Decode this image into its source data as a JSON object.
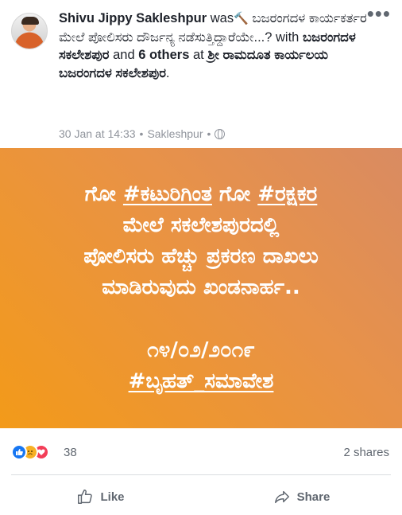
{
  "post": {
    "author": "Shivu Jippy Sakleshpur",
    "was_label": "was",
    "feeling_text": "ಬಜರಂಗದಳ ಕಾರ್ಯಕರ್ತರ ಮೇಲೆ ಪೋಲಿಸರು ದೌರ್ಜನ್ಯ ನಡೆಸುತ್ತಿದ್ದಾರೆಯೇ...?",
    "with_label": "with",
    "tagged_person": "ಬಜರಂಗದಳ ಸಕಲೇಶಪುರ",
    "and_label": "and",
    "others": "6 others",
    "at_label": "at",
    "location_tag": "ಶ್ರೀ ರಾಮದೂತ ಕಾರ್ಯಲಯ ಬಜರಂಗದಳ ಸಕಲೇಶಪುರ",
    "end_dot": ".",
    "timestamp": "30 Jan at 14:33",
    "place": "Sakleshpur",
    "separator": "•",
    "more_label": "•••"
  },
  "banner": {
    "background": "#f39a19",
    "line1_a": "ಗೋ ",
    "line1_b": "#ಕಟುರಿಗಿಂತ",
    "line1_c": " ಗೋ ",
    "line1_d": "#ರಕ್ಷಕರ",
    "line2": "ಮೇಲೆ ಸಕಲೇಶಪುರದಲ್ಲಿ",
    "line3": "ಪೋಲಿಸರು ಹೆಚ್ಚು ಪ್ರಕರಣ ದಾಖಲು",
    "line4": "ಮಾಡಿರುವುದು ಖಂಡನಾರ್ಹ..",
    "date": "೧೪/೦೨/೨೦೧೯",
    "hashtag": "#ಬೃಹತ್_ಸಮಾವೇಶ"
  },
  "reactions": {
    "count": "38",
    "shares": "2 shares",
    "icons": [
      "like-icon",
      "sad-icon",
      "love-icon"
    ]
  },
  "actions": {
    "like_label": "Like",
    "share_label": "Share"
  }
}
